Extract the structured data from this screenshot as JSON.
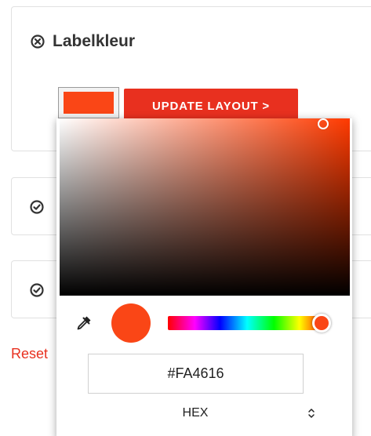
{
  "card_main": {
    "title": "Labelkleur",
    "title_icon": "x-circle-icon",
    "color_swatch": "#FA4616",
    "update_button_label": "UPDATE LAYOUT >"
  },
  "card_2": {
    "icon": "check-circle-icon"
  },
  "card_3": {
    "icon": "check-circle-icon"
  },
  "reset_label": "Reset",
  "color_picker": {
    "hex_value": "#FA4616",
    "format_label": "HEX",
    "format_icon": "up-down-arrows-icon",
    "eyedropper_icon": "eyedropper-icon",
    "preview_color": "#FA4616",
    "hue_fraction": 0.97
  },
  "colors": {
    "accent": "#E8301F",
    "selected": "#FA4616"
  }
}
